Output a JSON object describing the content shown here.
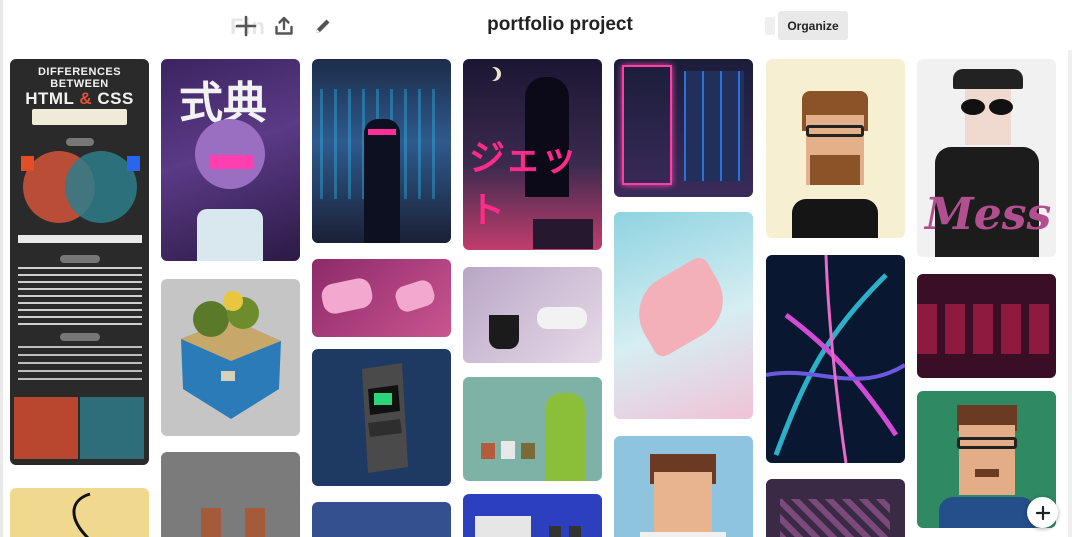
{
  "board": {
    "title": "portfolio project",
    "organize_label": "Organize",
    "ghost_label": "Fin",
    "toolbar_icons": [
      "plus-icon",
      "share-icon",
      "pencil-icon"
    ]
  },
  "infographic": {
    "title_line1": "DIFFERENCES BETWEEN",
    "title_html": "HTML",
    "title_amp": "&",
    "title_css": "CSS"
  },
  "pins": [
    {
      "id": "html-css-infographic"
    },
    {
      "id": "kanji-girl-helmet"
    },
    {
      "id": "robot-island"
    },
    {
      "id": "pixel-character-pair"
    },
    {
      "id": "neon-cyber-figure"
    },
    {
      "id": "pink-gamepad"
    },
    {
      "id": "pixel-arcade-cabinet"
    },
    {
      "id": "blue-card"
    },
    {
      "id": "jetto-poster"
    },
    {
      "id": "coffee-controllers"
    },
    {
      "id": "pixel-trio-characters"
    },
    {
      "id": "retro-console"
    },
    {
      "id": "neon-street"
    },
    {
      "id": "hand-pastel"
    },
    {
      "id": "pixel-man-portrait"
    },
    {
      "id": "pixel-bearded-portrait"
    },
    {
      "id": "neon-palm-leaves"
    },
    {
      "id": "pixel-room"
    },
    {
      "id": "mess-sunglasses-figure"
    },
    {
      "id": "arcade-red-room"
    },
    {
      "id": "pixel-glasses-portrait"
    }
  ],
  "fab": {
    "icon": "plus-icon"
  },
  "colors": {
    "organize_bg": "#e9e9e9",
    "title_text": "#222222",
    "accent_html": "#e2533b"
  }
}
